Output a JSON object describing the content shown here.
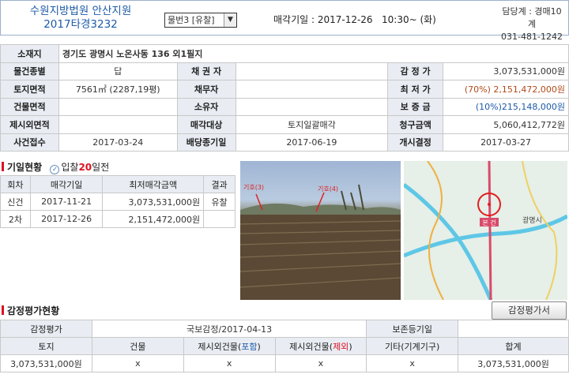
{
  "header": {
    "court_line1": "수원지방법원 안산지원",
    "court_line2": "2017타경3232",
    "item_select": "물번3 [유찰]",
    "date_line": "매각기일 : 2017-12-26   10:30~ (화)",
    "contact_line1": "담당계 : 경매10계",
    "contact_line2": "031-481-1242"
  },
  "info": {
    "address_label": "소재지",
    "address": "경기도 광명시 노온사동 136 외1필지",
    "type_label": "물건종별",
    "type": "답",
    "creditor_label": "채 권 자",
    "creditor": "",
    "appraisal_label": "감 정 가",
    "appraisal": "3,073,531,000원",
    "land_area_label": "토지면적",
    "land_area": "7561㎡ (2287,19평)",
    "debtor_label": "채무자",
    "debtor": "",
    "min_price_label": "최 저 가",
    "min_price": "(70%) 2,151,472,000원",
    "building_area_label": "건물면적",
    "building_area": "",
    "owner_label": "소유자",
    "owner": "",
    "deposit_label": "보 증 금",
    "deposit": "(10%)215,148,000원",
    "excluded_area_label": "제시외면적",
    "excluded_area": "",
    "sale_target_label": "매각대상",
    "sale_target": "토지일괄매각",
    "claim_label": "청구금액",
    "claim": "5,060,412,772원",
    "case_received_label": "사건접수",
    "case_received": "2017-03-24",
    "dividend_deadline_label": "배당종기일",
    "dividend_deadline": "2017-06-19",
    "start_decision_label": "개시결정",
    "start_decision": "2017-03-27"
  },
  "history": {
    "section_title": "기일현황",
    "bid_prefix": "입찰",
    "bid_days": "20",
    "bid_suffix": "일전",
    "headers": [
      "회차",
      "매각기일",
      "최저매각금액",
      "결과"
    ],
    "rows": [
      {
        "round": "신건",
        "date": "2017-11-21",
        "amount": "3,073,531,000원",
        "result": "유찰"
      },
      {
        "round": "2차",
        "date": "2017-12-26",
        "amount": "2,151,472,000원",
        "result": ""
      }
    ]
  },
  "photo": {
    "label_a": "기호(3)",
    "label_b": "기호(4)"
  },
  "map": {
    "marker_label": "본 건",
    "place_label": "광명시"
  },
  "appraisal": {
    "section_title": "감정평가현황",
    "button": "감정평가서",
    "row1_label": "감정평가",
    "row1_value": "국보감정/2017-04-13",
    "row1_label2": "보존등기일",
    "row1_value2": "",
    "cols": [
      "토지",
      "건물",
      "제시외건물(포함)",
      "제시외건물(제외)",
      "기타(기계기구)",
      "합계"
    ],
    "values": [
      "3,073,531,000원",
      "x",
      "x",
      "x",
      "x",
      "3,073,531,000원"
    ]
  }
}
